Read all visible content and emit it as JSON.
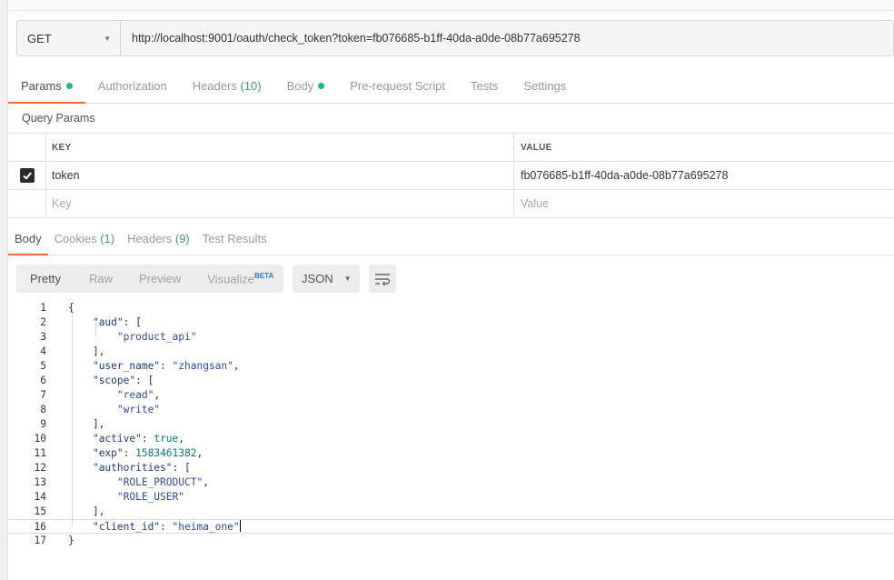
{
  "request": {
    "method": "GET",
    "url": "http://localhost:9001/oauth/check_token?token=fb076685-b1ff-40da-a0de-08b77a695278"
  },
  "request_tabs": [
    {
      "label": "Params",
      "count": "",
      "dot": true,
      "active": true
    },
    {
      "label": "Authorization",
      "count": "",
      "dot": false,
      "active": false
    },
    {
      "label": "Headers ",
      "count": "(10)",
      "dot": false,
      "active": false
    },
    {
      "label": "Body",
      "count": "",
      "dot": true,
      "active": false
    },
    {
      "label": "Pre-request Script",
      "count": "",
      "dot": false,
      "active": false
    },
    {
      "label": "Tests",
      "count": "",
      "dot": false,
      "active": false
    },
    {
      "label": "Settings",
      "count": "",
      "dot": false,
      "active": false
    }
  ],
  "query_params": {
    "title": "Query Params",
    "header_key": "KEY",
    "header_value": "VALUE",
    "rows": [
      {
        "key": "token",
        "value": "fb076685-b1ff-40da-a0de-08b77a695278",
        "checked": true
      }
    ],
    "placeholder_key": "Key",
    "placeholder_value": "Value"
  },
  "response_tabs": [
    {
      "label": "Body",
      "count": "",
      "active": true
    },
    {
      "label": "Cookies ",
      "count": "(1)",
      "active": false
    },
    {
      "label": "Headers ",
      "count": "(9)",
      "active": false
    },
    {
      "label": "Test Results",
      "count": "",
      "active": false
    }
  ],
  "view_modes": {
    "pretty": "Pretty",
    "raw": "Raw",
    "preview": "Preview",
    "visualize": "Visualize",
    "beta": "BETA",
    "format": "JSON"
  },
  "response_lines": [
    "{",
    "    \"aud\": [",
    "        \"product_api\"",
    "    ],",
    "    \"user_name\": \"zhangsan\",",
    "    \"scope\": [",
    "        \"read\",",
    "        \"write\"",
    "    ],",
    "    \"active\": true,",
    "    \"exp\": 1583461382,",
    "    \"authorities\": [",
    "        \"ROLE_PRODUCT\",",
    "        \"ROLE_USER\"",
    "    ],",
    "    \"client_id\": \"heima_one\"",
    "}"
  ],
  "colors": {
    "accent": "#f26b3a",
    "dot": "#26b47f",
    "count": "#4c9a5d",
    "beta": "#2a7bd1"
  }
}
